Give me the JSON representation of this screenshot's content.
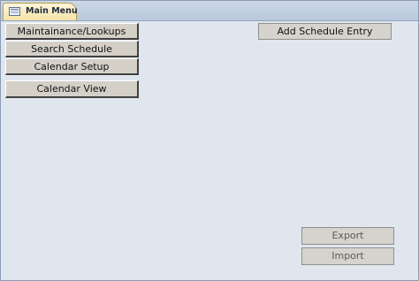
{
  "tabs": [
    {
      "label": "Main Menu",
      "icon": "form-icon",
      "active": true
    }
  ],
  "buttons": {
    "maintenance": "Maintainance/Lookups",
    "search_schedule": "Search Schedule",
    "calendar_setup": "Calendar Setup",
    "calendar_view": "Calendar View",
    "add_schedule_entry": "Add Schedule Entry",
    "export": "Export",
    "import": "Import"
  },
  "colors": {
    "form_background": "#dfe6ee",
    "button_face": "#d4d0c8",
    "tab_active": "#f6e2a6"
  }
}
